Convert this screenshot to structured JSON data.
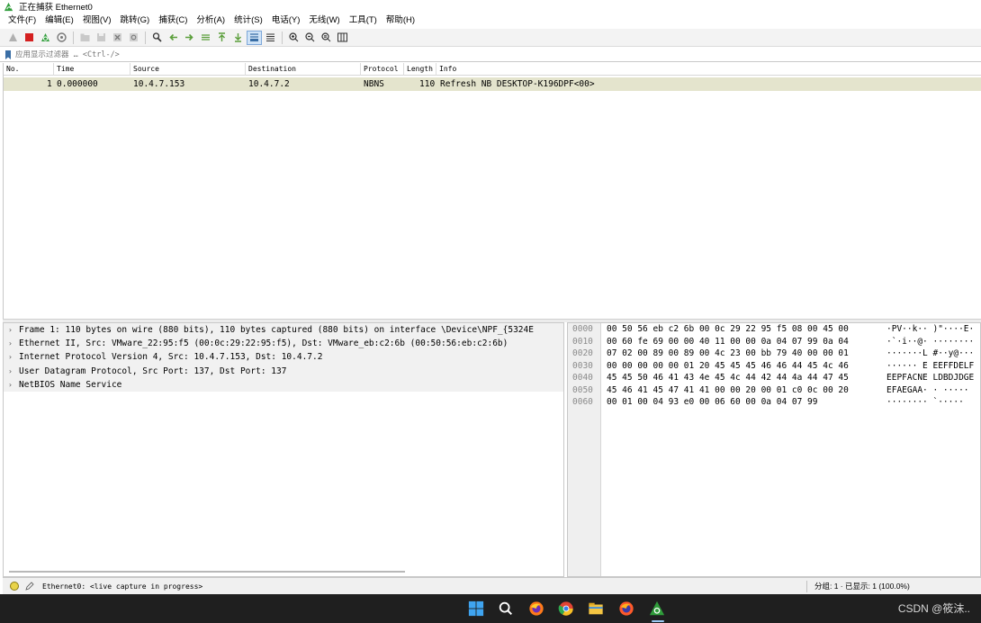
{
  "window": {
    "title": "正在捕获 Ethernet0"
  },
  "menu": [
    "文件(F)",
    "编辑(E)",
    "视图(V)",
    "跳转(G)",
    "捕获(C)",
    "分析(A)",
    "统计(S)",
    "电话(Y)",
    "无线(W)",
    "工具(T)",
    "帮助(H)"
  ],
  "filter": {
    "placeholder": "应用显示过滤器 … <Ctrl-/>"
  },
  "packet_list": {
    "columns": [
      "No.",
      "Time",
      "Source",
      "Destination",
      "Protocol",
      "Length",
      "Info"
    ],
    "rows": [
      {
        "no": "1",
        "time": "0.000000",
        "source": "10.4.7.153",
        "destination": "10.4.7.2",
        "protocol": "NBNS",
        "length": "110",
        "info": "Refresh NB DESKTOP-K196DPF<00>"
      }
    ]
  },
  "details": [
    "Frame 1: 110 bytes on wire (880 bits), 110 bytes captured (880 bits) on interface \\Device\\NPF_{5324E",
    "Ethernet II, Src: VMware_22:95:f5 (00:0c:29:22:95:f5), Dst: VMware_eb:c2:6b (00:50:56:eb:c2:6b)",
    "Internet Protocol Version 4, Src: 10.4.7.153, Dst: 10.4.7.2",
    "User Datagram Protocol, Src Port: 137, Dst Port: 137",
    "NetBIOS Name Service"
  ],
  "bytes": [
    {
      "offset": "0000",
      "hex": "00 50 56 eb c2 6b 00 0c  29 22 95 f5 08 00 45 00",
      "ascii": "·PV··k·· )\"····E·"
    },
    {
      "offset": "0010",
      "hex": "00 60 fe 69 00 00 40 11  00 00 0a 04 07 99 0a 04",
      "ascii": "·`·i··@· ········"
    },
    {
      "offset": "0020",
      "hex": "07 02 00 89 00 89 00 4c  23 00 bb 79 40 00 00 01",
      "ascii": "·······L #··y@···"
    },
    {
      "offset": "0030",
      "hex": "00 00 00 00 00 01 20 45  45 45 46 46 44 45 4c 46",
      "ascii": "······ E EEFFDELF"
    },
    {
      "offset": "0040",
      "hex": "45 45 50 46 41 43 4e 45  4c 44 42 44 4a 44 47 45",
      "ascii": "EEPFACNE LDBDJDGE"
    },
    {
      "offset": "0050",
      "hex": "45 46 41 45 47 41 41 00  00 20 00 01 c0 0c 00 20",
      "ascii": "EFAEGAA· · ····· "
    },
    {
      "offset": "0060",
      "hex": "00 01 00 04 93 e0 00 06  60 00 0a 04 07 99",
      "ascii": "········ `·····"
    }
  ],
  "status": {
    "text": "Ethernet0: <live capture in progress>",
    "counts": "分组: 1 · 已显示: 1 (100.0%)"
  },
  "taskbar": {
    "icons": [
      "windows-start-icon",
      "search-icon",
      "firefox-icon",
      "chrome-icon",
      "file-explorer-icon",
      "firefox-dev-icon",
      "wireshark-icon"
    ],
    "watermark": "CSDN @筱沫.."
  },
  "colors": {
    "selected_row": "#e4e4cd",
    "taskbar": "#1f1f1f",
    "wireshark_green": "#2f9d3a"
  }
}
